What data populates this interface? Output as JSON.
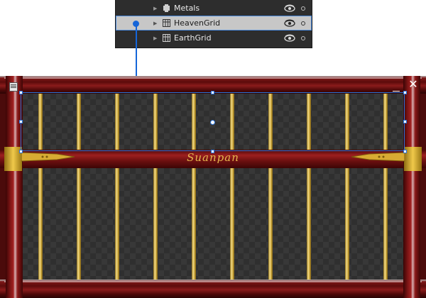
{
  "layers": [
    {
      "name": "Metals",
      "icon": "metals-icon",
      "selected": false
    },
    {
      "name": "HeavenGrid",
      "icon": "grid-icon",
      "selected": true
    },
    {
      "name": "EarthGrid",
      "icon": "grid-icon",
      "selected": false
    }
  ],
  "window": {
    "title_icon": "app-icon",
    "minimize_icon": "minimize-icon",
    "close_icon": "close-icon"
  },
  "abacus": {
    "beam_label": "Suanpan",
    "rod_count": 10
  },
  "colors": {
    "accent": "#1565d8",
    "wood": "#7a1414",
    "gold": "#e4b64e",
    "panel": "#2d2d2d"
  }
}
